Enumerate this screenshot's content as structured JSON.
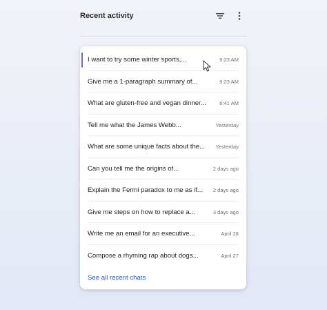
{
  "header": {
    "title": "Recent activity",
    "filter_icon": "filter-icon",
    "more_icon": "more-vert-icon"
  },
  "chats": [
    {
      "text": "I want to try some winter sports,...",
      "time": "9:23 AM"
    },
    {
      "text": "Give me a 1-paragraph summary of...",
      "time": "9:23 AM"
    },
    {
      "text": "What are gluten-free and vegan dinner...",
      "time": "8:41 AM"
    },
    {
      "text": "Tell me what the James Webb...",
      "time": "Yesterday"
    },
    {
      "text": "What are some unique facts about the...",
      "time": "Yesterday"
    },
    {
      "text": "Can you tell me the origins of...",
      "time": "2 days ago"
    },
    {
      "text": "Explain the Fermi paradox to me as if...",
      "time": "2 days ago"
    },
    {
      "text": "Give me steps on how to replace a...",
      "time": "3 days ago"
    },
    {
      "text": "Write me an email for an executive...",
      "time": "April 28"
    },
    {
      "text": "Compose a rhyming rap about dogs...",
      "time": "April 27"
    }
  ],
  "see_all_label": "See all recent chats",
  "colors": {
    "accent": "#5f6fd6",
    "link": "#2f5bc4"
  }
}
